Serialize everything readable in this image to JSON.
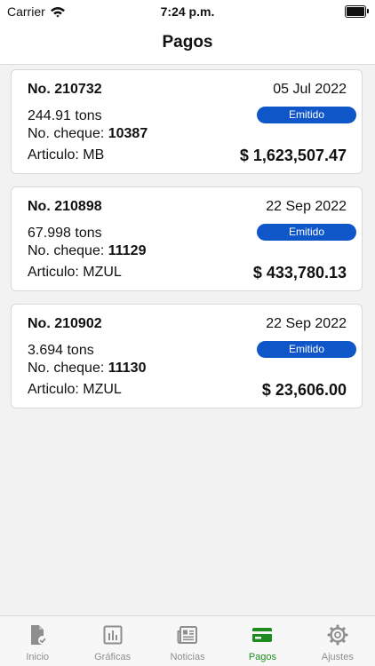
{
  "status_bar": {
    "carrier": "Carrier",
    "time": "7:24 p.m."
  },
  "nav": {
    "title": "Pagos"
  },
  "payments": [
    {
      "number": "No. 210732",
      "date": "05 Jul 2022",
      "tons": "244.91 tons",
      "cheque_label": "No. cheque:",
      "cheque_number": "10387",
      "status": "Emitido",
      "articulo": "Articulo: MB",
      "amount": "$ 1,623,507.47"
    },
    {
      "number": "No. 210898",
      "date": "22 Sep 2022",
      "tons": "67.998 tons",
      "cheque_label": "No. cheque:",
      "cheque_number": "11129",
      "status": "Emitido",
      "articulo": "Articulo: MZUL",
      "amount": "$ 433,780.13"
    },
    {
      "number": "No. 210902",
      "date": "22 Sep 2022",
      "tons": "3.694 tons",
      "cheque_label": "No. cheque:",
      "cheque_number": "11130",
      "status": "Emitido",
      "articulo": "Articulo: MZUL",
      "amount": "$ 23,606.00"
    }
  ],
  "tab_bar": {
    "items": [
      {
        "label": "Inicio",
        "icon": "document-check-icon"
      },
      {
        "label": "Gráficas",
        "icon": "bar-chart-icon"
      },
      {
        "label": "Noticias",
        "icon": "newspaper-icon"
      },
      {
        "label": "Pagos",
        "icon": "credit-card-icon",
        "active": true
      },
      {
        "label": "Ajustes",
        "icon": "gear-icon"
      }
    ]
  },
  "colors": {
    "badge_blue": "#0f56c9",
    "active_tab_green": "#1e8b1e",
    "inactive_tab_gray": "#8e8e8e",
    "background": "#f2f2f2"
  }
}
